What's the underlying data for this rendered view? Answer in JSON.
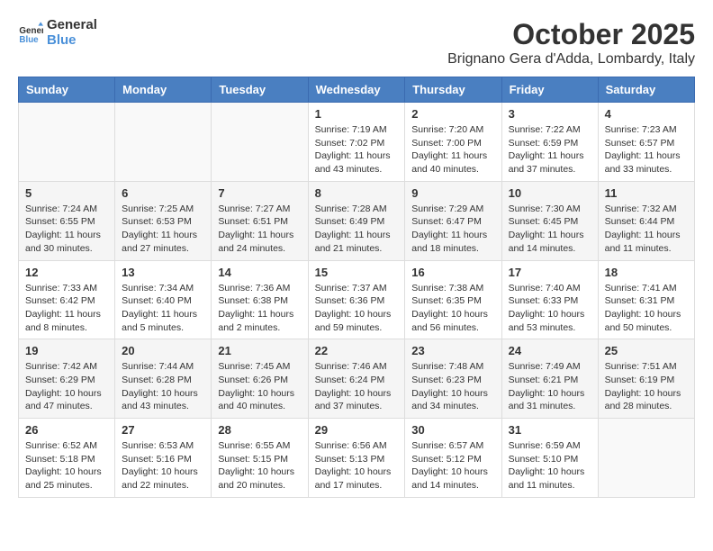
{
  "header": {
    "logo_general": "General",
    "logo_blue": "Blue",
    "month": "October 2025",
    "location": "Brignano Gera d'Adda, Lombardy, Italy"
  },
  "weekdays": [
    "Sunday",
    "Monday",
    "Tuesday",
    "Wednesday",
    "Thursday",
    "Friday",
    "Saturday"
  ],
  "weeks": [
    [
      {
        "day": "",
        "info": ""
      },
      {
        "day": "",
        "info": ""
      },
      {
        "day": "",
        "info": ""
      },
      {
        "day": "1",
        "info": "Sunrise: 7:19 AM\nSunset: 7:02 PM\nDaylight: 11 hours\nand 43 minutes."
      },
      {
        "day": "2",
        "info": "Sunrise: 7:20 AM\nSunset: 7:00 PM\nDaylight: 11 hours\nand 40 minutes."
      },
      {
        "day": "3",
        "info": "Sunrise: 7:22 AM\nSunset: 6:59 PM\nDaylight: 11 hours\nand 37 minutes."
      },
      {
        "day": "4",
        "info": "Sunrise: 7:23 AM\nSunset: 6:57 PM\nDaylight: 11 hours\nand 33 minutes."
      }
    ],
    [
      {
        "day": "5",
        "info": "Sunrise: 7:24 AM\nSunset: 6:55 PM\nDaylight: 11 hours\nand 30 minutes."
      },
      {
        "day": "6",
        "info": "Sunrise: 7:25 AM\nSunset: 6:53 PM\nDaylight: 11 hours\nand 27 minutes."
      },
      {
        "day": "7",
        "info": "Sunrise: 7:27 AM\nSunset: 6:51 PM\nDaylight: 11 hours\nand 24 minutes."
      },
      {
        "day": "8",
        "info": "Sunrise: 7:28 AM\nSunset: 6:49 PM\nDaylight: 11 hours\nand 21 minutes."
      },
      {
        "day": "9",
        "info": "Sunrise: 7:29 AM\nSunset: 6:47 PM\nDaylight: 11 hours\nand 18 minutes."
      },
      {
        "day": "10",
        "info": "Sunrise: 7:30 AM\nSunset: 6:45 PM\nDaylight: 11 hours\nand 14 minutes."
      },
      {
        "day": "11",
        "info": "Sunrise: 7:32 AM\nSunset: 6:44 PM\nDaylight: 11 hours\nand 11 minutes."
      }
    ],
    [
      {
        "day": "12",
        "info": "Sunrise: 7:33 AM\nSunset: 6:42 PM\nDaylight: 11 hours\nand 8 minutes."
      },
      {
        "day": "13",
        "info": "Sunrise: 7:34 AM\nSunset: 6:40 PM\nDaylight: 11 hours\nand 5 minutes."
      },
      {
        "day": "14",
        "info": "Sunrise: 7:36 AM\nSunset: 6:38 PM\nDaylight: 11 hours\nand 2 minutes."
      },
      {
        "day": "15",
        "info": "Sunrise: 7:37 AM\nSunset: 6:36 PM\nDaylight: 10 hours\nand 59 minutes."
      },
      {
        "day": "16",
        "info": "Sunrise: 7:38 AM\nSunset: 6:35 PM\nDaylight: 10 hours\nand 56 minutes."
      },
      {
        "day": "17",
        "info": "Sunrise: 7:40 AM\nSunset: 6:33 PM\nDaylight: 10 hours\nand 53 minutes."
      },
      {
        "day": "18",
        "info": "Sunrise: 7:41 AM\nSunset: 6:31 PM\nDaylight: 10 hours\nand 50 minutes."
      }
    ],
    [
      {
        "day": "19",
        "info": "Sunrise: 7:42 AM\nSunset: 6:29 PM\nDaylight: 10 hours\nand 47 minutes."
      },
      {
        "day": "20",
        "info": "Sunrise: 7:44 AM\nSunset: 6:28 PM\nDaylight: 10 hours\nand 43 minutes."
      },
      {
        "day": "21",
        "info": "Sunrise: 7:45 AM\nSunset: 6:26 PM\nDaylight: 10 hours\nand 40 minutes."
      },
      {
        "day": "22",
        "info": "Sunrise: 7:46 AM\nSunset: 6:24 PM\nDaylight: 10 hours\nand 37 minutes."
      },
      {
        "day": "23",
        "info": "Sunrise: 7:48 AM\nSunset: 6:23 PM\nDaylight: 10 hours\nand 34 minutes."
      },
      {
        "day": "24",
        "info": "Sunrise: 7:49 AM\nSunset: 6:21 PM\nDaylight: 10 hours\nand 31 minutes."
      },
      {
        "day": "25",
        "info": "Sunrise: 7:51 AM\nSunset: 6:19 PM\nDaylight: 10 hours\nand 28 minutes."
      }
    ],
    [
      {
        "day": "26",
        "info": "Sunrise: 6:52 AM\nSunset: 5:18 PM\nDaylight: 10 hours\nand 25 minutes."
      },
      {
        "day": "27",
        "info": "Sunrise: 6:53 AM\nSunset: 5:16 PM\nDaylight: 10 hours\nand 22 minutes."
      },
      {
        "day": "28",
        "info": "Sunrise: 6:55 AM\nSunset: 5:15 PM\nDaylight: 10 hours\nand 20 minutes."
      },
      {
        "day": "29",
        "info": "Sunrise: 6:56 AM\nSunset: 5:13 PM\nDaylight: 10 hours\nand 17 minutes."
      },
      {
        "day": "30",
        "info": "Sunrise: 6:57 AM\nSunset: 5:12 PM\nDaylight: 10 hours\nand 14 minutes."
      },
      {
        "day": "31",
        "info": "Sunrise: 6:59 AM\nSunset: 5:10 PM\nDaylight: 10 hours\nand 11 minutes."
      },
      {
        "day": "",
        "info": ""
      }
    ]
  ]
}
